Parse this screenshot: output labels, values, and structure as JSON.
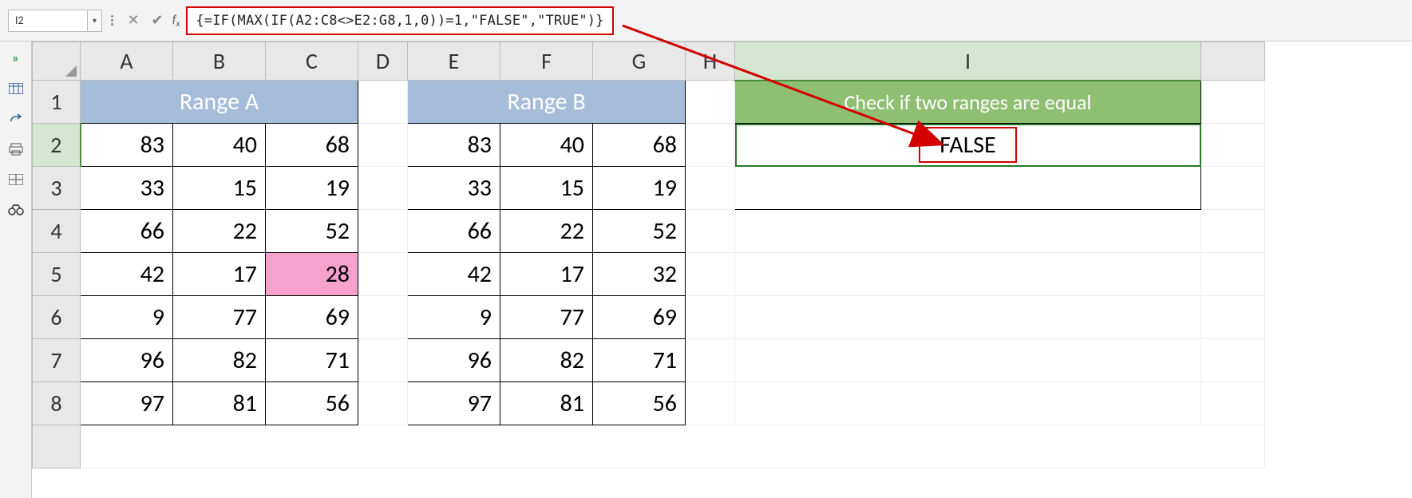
{
  "nameBox": "I2",
  "formula": "{=IF(MAX(IF(A2:C8<>E2:G8,1,0))=1,\"FALSE\",\"TRUE\")}",
  "columns": [
    "A",
    "B",
    "C",
    "D",
    "E",
    "F",
    "G",
    "H",
    "I"
  ],
  "rowNumbers": [
    "1",
    "2",
    "3",
    "4",
    "5",
    "6",
    "7",
    "8"
  ],
  "headers": {
    "rangeA": "Range A",
    "rangeB": "Range B",
    "check": "Check if two ranges are equal"
  },
  "rangeA": [
    [
      83,
      40,
      68
    ],
    [
      33,
      15,
      19
    ],
    [
      66,
      22,
      52
    ],
    [
      42,
      17,
      28
    ],
    [
      9,
      77,
      69
    ],
    [
      96,
      82,
      71
    ],
    [
      97,
      81,
      56
    ]
  ],
  "rangeB": [
    [
      83,
      40,
      68
    ],
    [
      33,
      15,
      19
    ],
    [
      66,
      22,
      52
    ],
    [
      42,
      17,
      32
    ],
    [
      9,
      77,
      69
    ],
    [
      96,
      82,
      71
    ],
    [
      97,
      81,
      56
    ]
  ],
  "result": "FALSE",
  "highlightCell": "C5",
  "leftIcons": [
    "expand",
    "table",
    "redo",
    "print",
    "grid",
    "binoculars"
  ]
}
